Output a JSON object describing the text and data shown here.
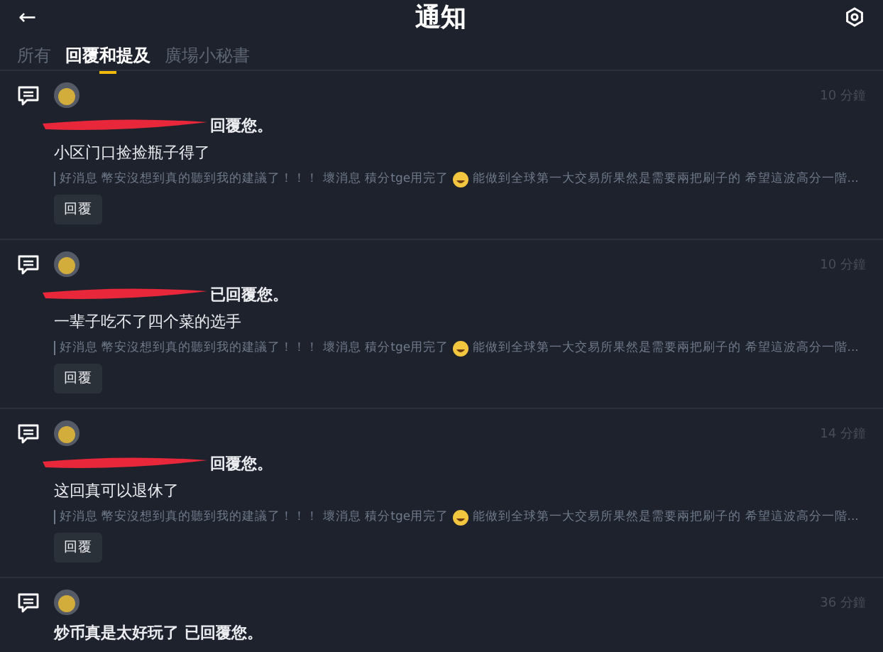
{
  "header": {
    "back": "←",
    "title": "通知"
  },
  "tabs": [
    {
      "label": "所有",
      "selected": false
    },
    {
      "label": "回覆和提及",
      "selected": true
    },
    {
      "label": "廣場小秘書",
      "selected": false
    }
  ],
  "notifications": [
    {
      "time": "10 分鐘",
      "redacted": true,
      "headline": "回覆您。",
      "body": "小区门口捡捡瓶子得了",
      "quote_before": "好消息 幣安沒想到真的聽到我的建議了！！！ 壞消息 積分tge用完了",
      "quote_after": "能做到全球第一大交易所果然是需要兩把刷子的 希望這波高分一階...",
      "reply": "回覆"
    },
    {
      "time": "10 分鐘",
      "redacted": true,
      "headline": "已回覆您。",
      "body": "一辈子吃不了四个菜的选手",
      "quote_before": "好消息 幣安沒想到真的聽到我的建議了！！！ 壞消息 積分tge用完了",
      "quote_after": "能做到全球第一大交易所果然是需要兩把刷子的 希望這波高分一階...",
      "reply": "回覆"
    },
    {
      "time": "14 分鐘",
      "redacted": true,
      "headline": "回覆您。",
      "body": "这回真可以退休了",
      "quote_before": "好消息 幣安沒想到真的聽到我的建議了！！！ 壞消息 積分tge用完了",
      "quote_after": "能做到全球第一大交易所果然是需要兩把刷子的 希望這波高分一階...",
      "reply": "回覆"
    },
    {
      "time": "36 分鐘",
      "redacted": false,
      "headline": "炒币真是太好玩了 已回覆您。"
    }
  ]
}
